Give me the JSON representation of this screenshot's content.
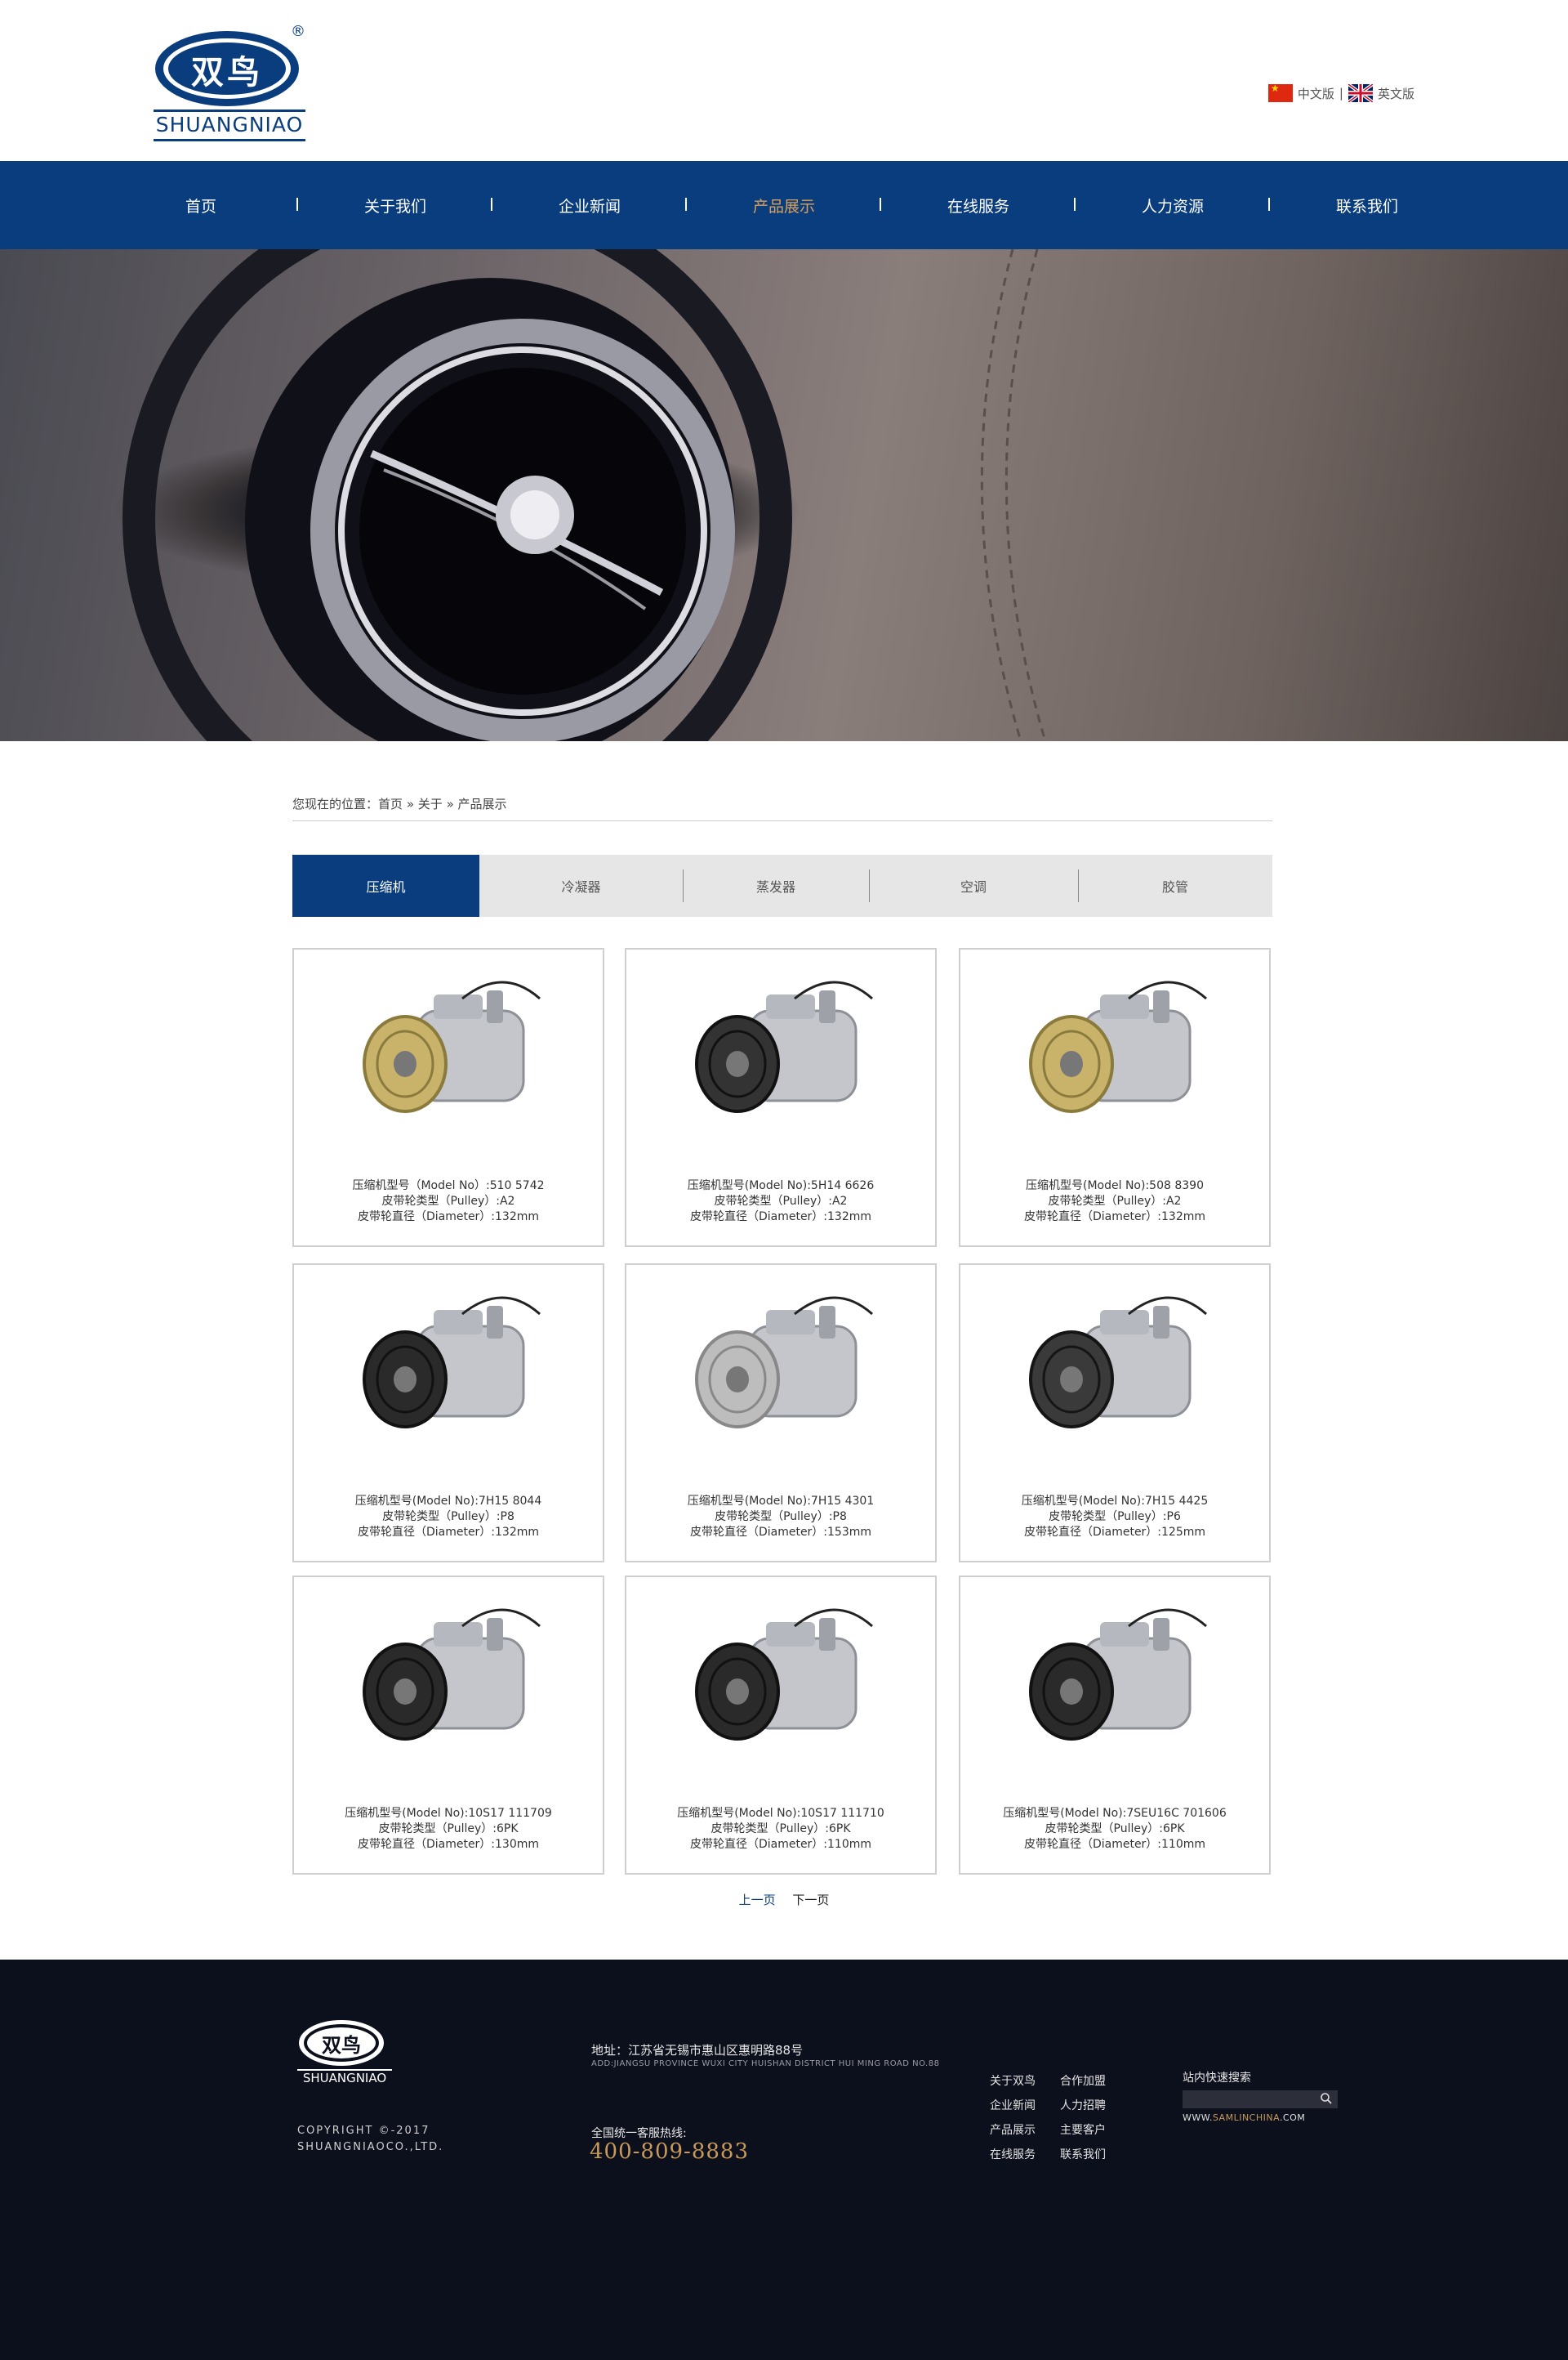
{
  "header": {
    "logo_cn": "双鸟",
    "logo_en": "SHUANGNIAO",
    "registered": "®",
    "lang_cn": "中文版",
    "lang_sep": "|",
    "lang_en": "英文版"
  },
  "nav": [
    "首页",
    "关于我们",
    "企业新闻",
    "产品展示",
    "在线服务",
    "人力资源",
    "联系我们"
  ],
  "nav_active_index": 3,
  "breadcrumb": {
    "prefix": "您现在的位置：",
    "items": [
      "首页",
      "关于",
      "产品展示"
    ],
    "sep": "»"
  },
  "tabs": [
    "压缩机",
    "冷凝器",
    "蒸发器",
    "空调",
    "胶管"
  ],
  "products": [
    {
      "line1": "压缩机型号（Model No）:510 5742",
      "line2": "皮带轮类型（Pulley）:A2",
      "line3": "皮带轮直径（Diameter）:132mm"
    },
    {
      "line1": "压缩机型号(Model No):5H14 6626",
      "line2": "皮带轮类型（Pulley）:A2",
      "line3": "皮带轮直径（Diameter）:132mm"
    },
    {
      "line1": "压缩机型号(Model No):508 8390",
      "line2": "皮带轮类型（Pulley）:A2",
      "line3": "皮带轮直径（Diameter）:132mm"
    },
    {
      "line1": "压缩机型号(Model No):7H15 8044",
      "line2": "皮带轮类型（Pulley）:P8",
      "line3": "皮带轮直径（Diameter）:132mm"
    },
    {
      "line1": "压缩机型号(Model No):7H15 4301",
      "line2": "皮带轮类型（Pulley）:P8",
      "line3": "皮带轮直径（Diameter）:153mm"
    },
    {
      "line1": "压缩机型号(Model No):7H15 4425",
      "line2": "皮带轮类型（Pulley）:P6",
      "line3": "皮带轮直径（Diameter）:125mm"
    },
    {
      "line1": "压缩机型号(Model No):10S17 111709",
      "line2": "皮带轮类型（Pulley）:6PK",
      "line3": "皮带轮直径（Diameter）:130mm"
    },
    {
      "line1": "压缩机型号(Model No):10S17 111710",
      "line2": "皮带轮类型（Pulley）:6PK",
      "line3": "皮带轮直径（Diameter）:110mm"
    },
    {
      "line1": "压缩机型号(Model No):7SEU16C 701606",
      "line2": "皮带轮类型（Pulley）:6PK",
      "line3": "皮带轮直径（Diameter）:110mm"
    }
  ],
  "pager": {
    "prev": "上一页",
    "next": "下一页"
  },
  "footer": {
    "logo_cn": "双鸟",
    "logo_en": "SHUANGNIAO",
    "copyright1": "COPYRIGHT ©-2017",
    "copyright2": "SHUANGNIAOCO.,LTD.",
    "address_cn": "地址：江苏省无锡市惠山区惠明路88号",
    "address_en": "ADD:JIANGSU PROVINCE WUXI CITY HUISHAN DISTRICT HUI MING ROAD NO.88",
    "hotline_label": "全国统一客服热线:",
    "hotline": "400-809-8883",
    "links_col1": [
      "关于双鸟",
      "企业新闻",
      "产品展示",
      "在线服务"
    ],
    "links_col2": [
      "合作加盟",
      "人力招聘",
      "主要客户",
      "联系我们"
    ],
    "search_title": "站内快速搜索",
    "site_prefix": "WWW.",
    "site_brand": "SAMLINCHINA",
    "site_suffix": ".COM"
  },
  "colors": {
    "nav_bg": "#0a3d7e",
    "nav_active": "#d9a05b",
    "footer_bg": "#0c0f1c",
    "hotline": "#c89a5a"
  }
}
